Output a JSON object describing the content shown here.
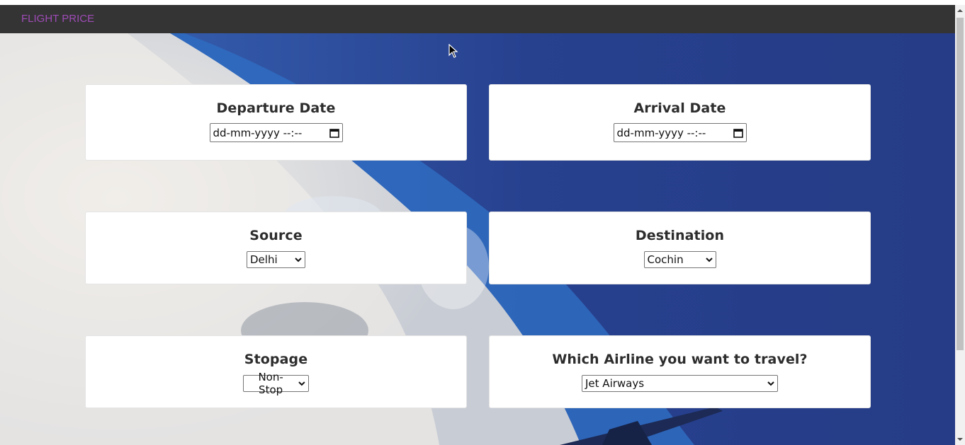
{
  "navbar": {
    "brand": "FLIGHT PRICE"
  },
  "form": {
    "departure": {
      "label": "Departure Date",
      "placeholder": "dd-mm-yyyy --:--"
    },
    "arrival": {
      "label": "Arrival Date",
      "placeholder": "dd-mm-yyyy --:--"
    },
    "source": {
      "label": "Source",
      "selected": "Delhi"
    },
    "destination": {
      "label": "Destination",
      "selected": "Cochin"
    },
    "stopage": {
      "label": "Stopage",
      "selected": "Non-Stop"
    },
    "airline": {
      "label": "Which Airline you want to travel?",
      "selected": "Jet Airways"
    }
  },
  "colors": {
    "brand": "#9d4bb5",
    "navbar_bg": "#343434",
    "sky": "#263f8c"
  },
  "icons": [
    "calendar-icon",
    "chevron-down-icon",
    "mouse-cursor-icon"
  ]
}
